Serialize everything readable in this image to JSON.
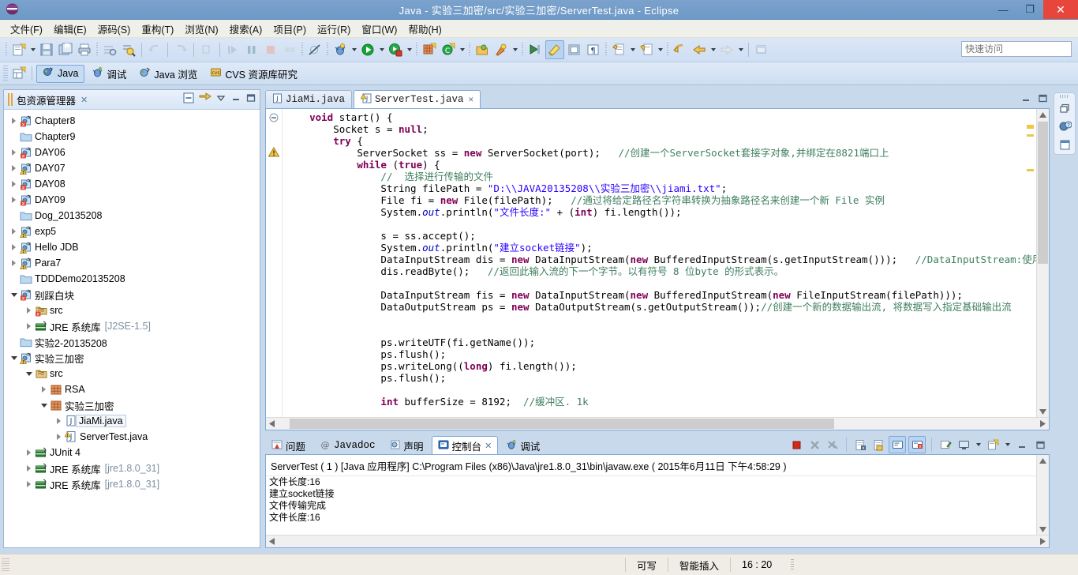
{
  "window": {
    "title": "Java - 实验三加密/src/实验三加密/ServerTest.java - Eclipse",
    "minimize": "—",
    "maximize": "❐",
    "close": "✕"
  },
  "menu": {
    "items": [
      {
        "label": "文件(F)"
      },
      {
        "label": "编辑(E)"
      },
      {
        "label": "源码(S)"
      },
      {
        "label": "重构(T)"
      },
      {
        "label": "浏览(N)"
      },
      {
        "label": "搜索(A)"
      },
      {
        "label": "项目(P)"
      },
      {
        "label": "运行(R)"
      },
      {
        "label": "窗口(W)"
      },
      {
        "label": "帮助(H)"
      }
    ]
  },
  "toolbar": {
    "quick_access_placeholder": "快速访问"
  },
  "perspective": {
    "items": [
      {
        "label": "Java",
        "active": true
      },
      {
        "label": "调试",
        "active": false
      },
      {
        "label": "Java 浏览",
        "active": false
      },
      {
        "label": "CVS 资源库研究",
        "active": false
      }
    ]
  },
  "package_explorer": {
    "title": "包资源管理器",
    "tree": [
      {
        "label": "Chapter8",
        "indent": 0,
        "twisty": "closed",
        "icon": "java-project-error"
      },
      {
        "label": "Chapter9",
        "indent": 0,
        "twisty": "none",
        "icon": "folder"
      },
      {
        "label": "DAY06",
        "indent": 0,
        "twisty": "closed",
        "icon": "java-project-error"
      },
      {
        "label": "DAY07",
        "indent": 0,
        "twisty": "closed",
        "icon": "java-project-warning"
      },
      {
        "label": "DAY08",
        "indent": 0,
        "twisty": "closed",
        "icon": "java-project-error"
      },
      {
        "label": "DAY09",
        "indent": 0,
        "twisty": "closed",
        "icon": "java-project-error"
      },
      {
        "label": "Dog_20135208",
        "indent": 0,
        "twisty": "none",
        "icon": "folder"
      },
      {
        "label": "exp5",
        "indent": 0,
        "twisty": "closed",
        "icon": "java-project-warning"
      },
      {
        "label": "Hello JDB",
        "indent": 0,
        "twisty": "closed",
        "icon": "java-project-warning"
      },
      {
        "label": "Para7",
        "indent": 0,
        "twisty": "closed",
        "icon": "java-project-warning"
      },
      {
        "label": "TDDDemo20135208",
        "indent": 0,
        "twisty": "none",
        "icon": "folder"
      },
      {
        "label": "别踩白块",
        "indent": 0,
        "twisty": "open",
        "icon": "java-project-error"
      },
      {
        "label": "src",
        "indent": 1,
        "twisty": "closed",
        "icon": "source-folder-error"
      },
      {
        "label": "JRE 系统库",
        "indent": 1,
        "twisty": "closed",
        "icon": "library",
        "suffix": "[J2SE-1.5]"
      },
      {
        "label": "实验2-20135208",
        "indent": 0,
        "twisty": "none",
        "icon": "folder"
      },
      {
        "label": "实验三加密",
        "indent": 0,
        "twisty": "open",
        "icon": "java-project-warning"
      },
      {
        "label": "src",
        "indent": 1,
        "twisty": "open",
        "icon": "source-folder"
      },
      {
        "label": "RSA",
        "indent": 2,
        "twisty": "closed",
        "icon": "package"
      },
      {
        "label": "实验三加密",
        "indent": 2,
        "twisty": "open",
        "icon": "package"
      },
      {
        "label": "JiaMi.java",
        "indent": 3,
        "twisty": "closed",
        "icon": "java-file",
        "selected": true
      },
      {
        "label": "ServerTest.java",
        "indent": 3,
        "twisty": "closed",
        "icon": "java-file-warning"
      },
      {
        "label": "JUnit 4",
        "indent": 1,
        "twisty": "closed",
        "icon": "library"
      },
      {
        "label": "JRE 系统库",
        "indent": 1,
        "twisty": "closed",
        "icon": "library",
        "suffix": "[jre1.8.0_31]"
      },
      {
        "label": "JRE 系统库",
        "indent": 1,
        "twisty": "closed",
        "icon": "library",
        "suffix": "[jre1.8.0_31]"
      }
    ]
  },
  "editor": {
    "tabs": [
      {
        "label": "JiaMi.java",
        "active": false,
        "icon": "java-file",
        "closable": false
      },
      {
        "label": "ServerTest.java",
        "active": true,
        "icon": "java-file-warning",
        "closable": true,
        "close": "✕"
      }
    ],
    "code_lines": [
      {
        "indent": 4,
        "tokens": [
          {
            "t": "kw",
            "v": "void"
          },
          {
            "t": "p",
            "v": " start() {"
          }
        ]
      },
      {
        "indent": 8,
        "tokens": [
          {
            "t": "p",
            "v": "Socket s = "
          },
          {
            "t": "kw",
            "v": "null"
          },
          {
            "t": "p",
            "v": ";"
          }
        ]
      },
      {
        "indent": 8,
        "tokens": [
          {
            "t": "kw",
            "v": "try"
          },
          {
            "t": "p",
            "v": " {"
          }
        ]
      },
      {
        "indent": 12,
        "tokens": [
          {
            "t": "p",
            "v": "ServerSocket ss = "
          },
          {
            "t": "kw",
            "v": "new"
          },
          {
            "t": "p",
            "v": " ServerSocket(port);   "
          },
          {
            "t": "cmt",
            "v": "//创建一个ServerSocket套接字对象,并绑定在8821端口上"
          }
        ]
      },
      {
        "indent": 12,
        "tokens": [
          {
            "t": "kw",
            "v": "while"
          },
          {
            "t": "p",
            "v": " ("
          },
          {
            "t": "kw",
            "v": "true"
          },
          {
            "t": "p",
            "v": ") {"
          }
        ]
      },
      {
        "indent": 16,
        "tokens": [
          {
            "t": "cmt",
            "v": "//  选择进行传输的文件"
          }
        ]
      },
      {
        "indent": 16,
        "tokens": [
          {
            "t": "p",
            "v": "String filePath = "
          },
          {
            "t": "str",
            "v": "\"D:\\\\JAVA20135208\\\\实验三加密\\\\jiami.txt\""
          },
          {
            "t": "p",
            "v": ";"
          }
        ]
      },
      {
        "indent": 16,
        "tokens": [
          {
            "t": "p",
            "v": "File fi = "
          },
          {
            "t": "kw",
            "v": "new"
          },
          {
            "t": "p",
            "v": " File(filePath);   "
          },
          {
            "t": "cmt",
            "v": "//通过将给定路径名字符串转换为抽象路径名来创建一个新 File 实例"
          }
        ]
      },
      {
        "indent": 16,
        "tokens": [
          {
            "t": "p",
            "v": "System."
          },
          {
            "t": "fld",
            "v": "out"
          },
          {
            "t": "p",
            "v": ".println("
          },
          {
            "t": "str",
            "v": "\"文件长度:\""
          },
          {
            "t": "p",
            "v": " + ("
          },
          {
            "t": "kw",
            "v": "int"
          },
          {
            "t": "p",
            "v": ") fi.length());"
          }
        ]
      },
      {
        "indent": 0,
        "tokens": []
      },
      {
        "indent": 16,
        "tokens": [
          {
            "t": "p",
            "v": "s = ss.accept();"
          }
        ]
      },
      {
        "indent": 16,
        "tokens": [
          {
            "t": "p",
            "v": "System."
          },
          {
            "t": "fld",
            "v": "out"
          },
          {
            "t": "p",
            "v": ".println("
          },
          {
            "t": "str",
            "v": "\"建立socket链接\""
          },
          {
            "t": "p",
            "v": ");"
          }
        ]
      },
      {
        "indent": 16,
        "tokens": [
          {
            "t": "p",
            "v": "DataInputStream dis = "
          },
          {
            "t": "kw",
            "v": "new"
          },
          {
            "t": "p",
            "v": " DataInputStream("
          },
          {
            "t": "kw",
            "v": "new"
          },
          {
            "t": "p",
            "v": " BufferedInputStream(s.getInputStream()));   "
          },
          {
            "t": "cmt",
            "v": "//DataInputStream:使用指定的"
          }
        ]
      },
      {
        "indent": 16,
        "tokens": [
          {
            "t": "p",
            "v": "dis.readByte();   "
          },
          {
            "t": "cmt",
            "v": "//返回此输入流的下一个字节。以有符号 8 位byte 的形式表示。"
          }
        ]
      },
      {
        "indent": 0,
        "tokens": []
      },
      {
        "indent": 16,
        "tokens": [
          {
            "t": "p",
            "v": "DataInputStream fis = "
          },
          {
            "t": "kw",
            "v": "new"
          },
          {
            "t": "p",
            "v": " DataInputStream("
          },
          {
            "t": "kw",
            "v": "new"
          },
          {
            "t": "p",
            "v": " BufferedInputStream("
          },
          {
            "t": "kw",
            "v": "new"
          },
          {
            "t": "p",
            "v": " FileInputStream(filePath)));"
          }
        ]
      },
      {
        "indent": 16,
        "tokens": [
          {
            "t": "p",
            "v": "DataOutputStream ps = "
          },
          {
            "t": "kw",
            "v": "new"
          },
          {
            "t": "p",
            "v": " DataOutputStream(s.getOutputStream());"
          },
          {
            "t": "cmt",
            "v": "//创建一个新的数据输出流, 将数据写入指定基础输出流"
          }
        ]
      },
      {
        "indent": 0,
        "tokens": []
      },
      {
        "indent": 0,
        "tokens": []
      },
      {
        "indent": 16,
        "tokens": [
          {
            "t": "p",
            "v": "ps.writeUTF(fi.getName());"
          }
        ]
      },
      {
        "indent": 16,
        "tokens": [
          {
            "t": "p",
            "v": "ps.flush();"
          }
        ]
      },
      {
        "indent": 16,
        "tokens": [
          {
            "t": "p",
            "v": "ps.writeLong(("
          },
          {
            "t": "kw",
            "v": "long"
          },
          {
            "t": "p",
            "v": ") fi.length());"
          }
        ]
      },
      {
        "indent": 16,
        "tokens": [
          {
            "t": "p",
            "v": "ps.flush();"
          }
        ]
      },
      {
        "indent": 0,
        "tokens": []
      },
      {
        "indent": 16,
        "tokens": [
          {
            "t": "kw",
            "v": "int"
          },
          {
            "t": "p",
            "v": " bufferSize = 8192;  "
          },
          {
            "t": "cmt",
            "v": "//缓冲区. 1k"
          }
        ]
      }
    ]
  },
  "console": {
    "tabs": [
      {
        "label": "问题",
        "active": false,
        "icon": "problems-icon"
      },
      {
        "label": "Javadoc",
        "active": false,
        "icon": "javadoc-icon"
      },
      {
        "label": "声明",
        "active": false,
        "icon": "declaration-icon"
      },
      {
        "label": "控制台",
        "active": true,
        "icon": "console-icon",
        "close": "✕"
      },
      {
        "label": "调试",
        "active": false,
        "icon": "debug-icon"
      }
    ],
    "launch_line": "ServerTest ( 1 )  [Java 应用程序] C:\\Program Files (x86)\\Java\\jre1.8.0_31\\bin\\javaw.exe ( 2015年6月11日 下午4:58:29 )",
    "output": [
      "文件长度:16",
      "建立socket链接",
      "文件传输完成",
      "文件长度:16"
    ]
  },
  "status_bar": {
    "writable": "可写",
    "insert_mode": "智能插入",
    "cursor_position": "16 : 20"
  },
  "colors": {
    "title_bg": "#7ba2cc",
    "close_red": "#e8453c",
    "toolbar_bg": "#d4e2f3",
    "keyword": "#7f0055",
    "string": "#2a00ff",
    "comment": "#3f7f5f",
    "field": "#0000c0",
    "selection": "#c6dcf3"
  }
}
